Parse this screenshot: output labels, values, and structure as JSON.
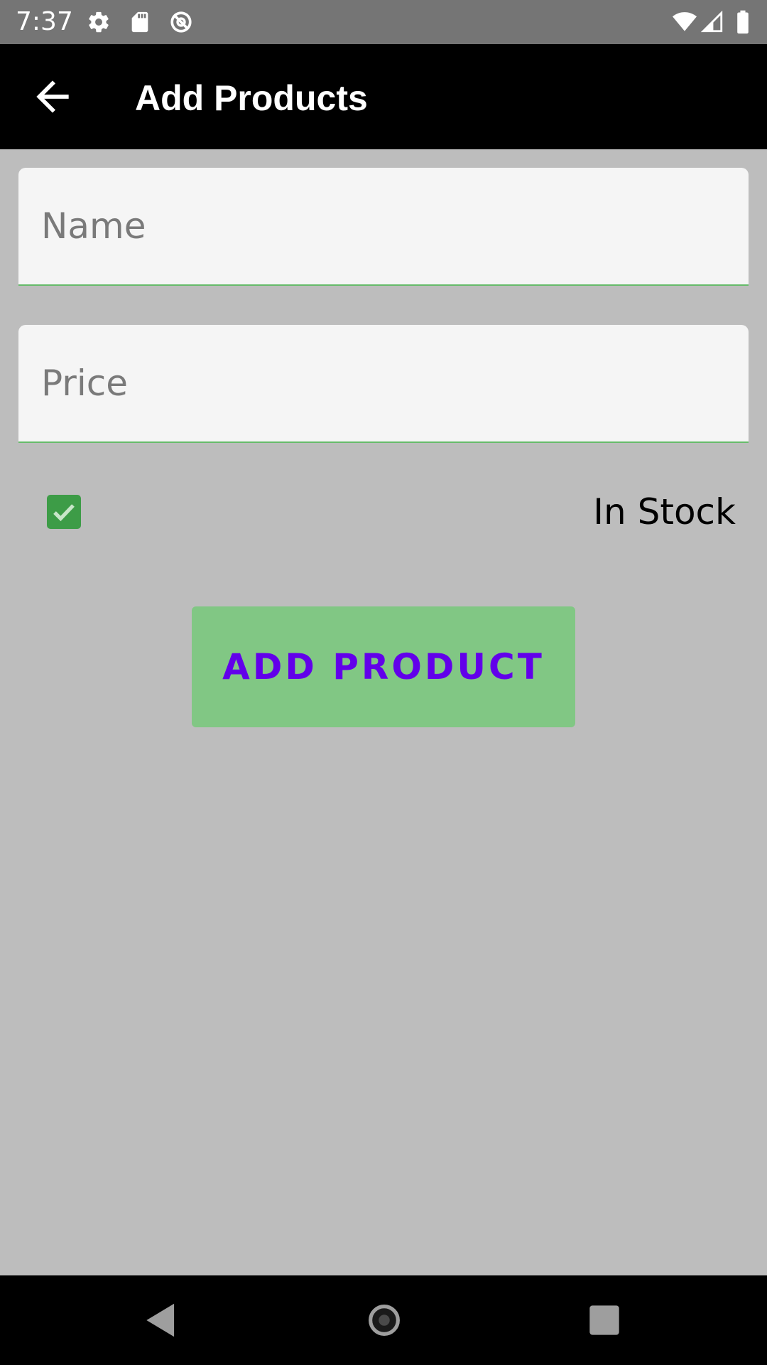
{
  "status_bar": {
    "time": "7:37",
    "left_icons": [
      "gear-icon",
      "sd-card-icon",
      "data-saver-icon"
    ],
    "right_icons": [
      "wifi-icon",
      "cell-signal-icon",
      "battery-icon"
    ]
  },
  "app_bar": {
    "title": "Add Products",
    "back_icon": "arrow-back-icon"
  },
  "form": {
    "name_placeholder": "Name",
    "name_value": "",
    "price_placeholder": "Price",
    "price_value": "",
    "in_stock_checked": true,
    "in_stock_label": "In Stock",
    "submit_label": "ADD PRODUCT"
  },
  "nav_bar": {
    "icons": [
      "back-triangle-icon",
      "home-circle-icon",
      "recents-square-icon"
    ]
  },
  "colors": {
    "status_bar_bg": "#757575",
    "app_bar_bg": "#000000",
    "page_bg": "#bdbdbd",
    "field_bg": "#f5f5f5",
    "field_underline": "#66bb6a",
    "checkbox": "#3d9c47",
    "button_bg": "#81c784",
    "button_text": "#6200ea"
  }
}
